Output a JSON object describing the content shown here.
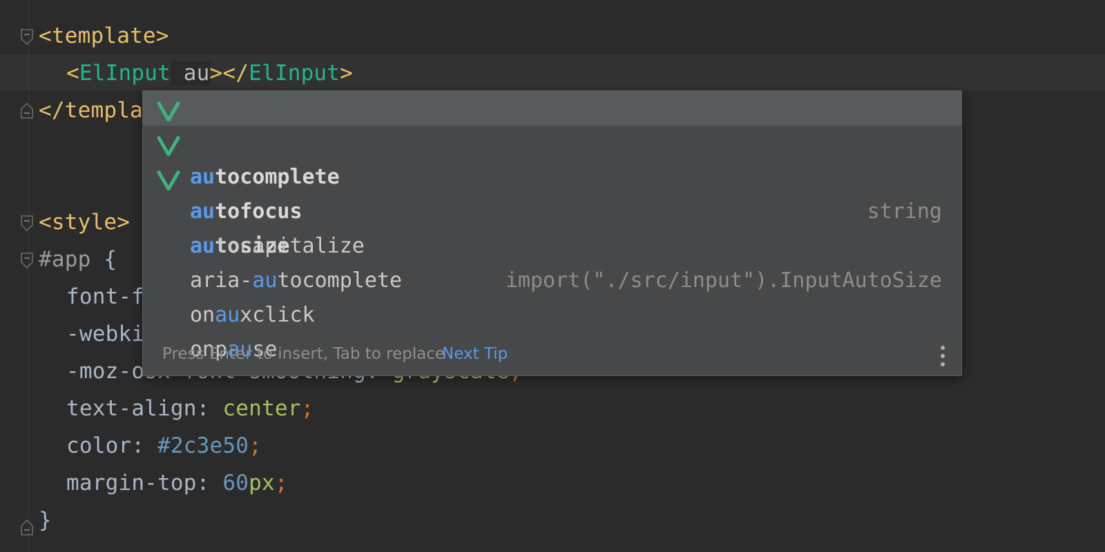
{
  "editor": {
    "lines": {
      "l1": {
        "open": "<",
        "tag": "template",
        "close": ">"
      },
      "l2": {
        "open": "<",
        "comp": "ElInput",
        "attr": " au",
        "mid": "></",
        "comp2": "ElInput",
        "close": ">"
      },
      "l3": {
        "open": "</",
        "tag": "templa"
      },
      "l5": {
        "open": "<",
        "tag": "style",
        "close": ">"
      },
      "l6": {
        "selector": "#app",
        "brace": " {"
      },
      "l7": {
        "prop": "font-f"
      },
      "l8": {
        "prop": "-webki"
      },
      "l9": {
        "prop": "-moz-osx-font-smoothing: ",
        "val": "grayscale",
        "semi": ";"
      },
      "l10": {
        "prop": "text-align: ",
        "val": "center",
        "semi": ";"
      },
      "l11": {
        "prop": "color: ",
        "val": "#2c3e50",
        "semi": ";"
      },
      "l12": {
        "prop": "margin-top: ",
        "num": "60",
        "unit": "px",
        "semi": ";"
      },
      "l13": {
        "brace": "}"
      }
    },
    "colors": {
      "tag": "#e8bf6a",
      "component": "#22b68f",
      "value": "#a5c25c",
      "number": "#6897bb",
      "keyword": "#cc7832"
    }
  },
  "completion": {
    "items": [
      {
        "icon": "vue-icon",
        "match": "au",
        "rest": "tocomplete",
        "type": "string"
      },
      {
        "icon": "vue-icon",
        "match": "au",
        "rest": "tofocus",
        "type": ""
      },
      {
        "icon": "vue-icon",
        "match": "au",
        "rest": "tosize",
        "type": "import(\"./src/input\").InputAutoSize"
      },
      {
        "prefix": "",
        "match": "au",
        "rest": "tocapitalize"
      },
      {
        "prefix": "aria-",
        "match": "au",
        "rest": "tocomplete"
      },
      {
        "prefix": "on",
        "match": "au",
        "rest": "xclick"
      },
      {
        "prefix": "onp",
        "match": "au",
        "rest": "se"
      }
    ],
    "footer": {
      "hint": "Press Enter to insert, Tab to replace",
      "tip": "Next Tip"
    },
    "accent": "#5b9ae6",
    "vue_color": "#3fb27f"
  }
}
